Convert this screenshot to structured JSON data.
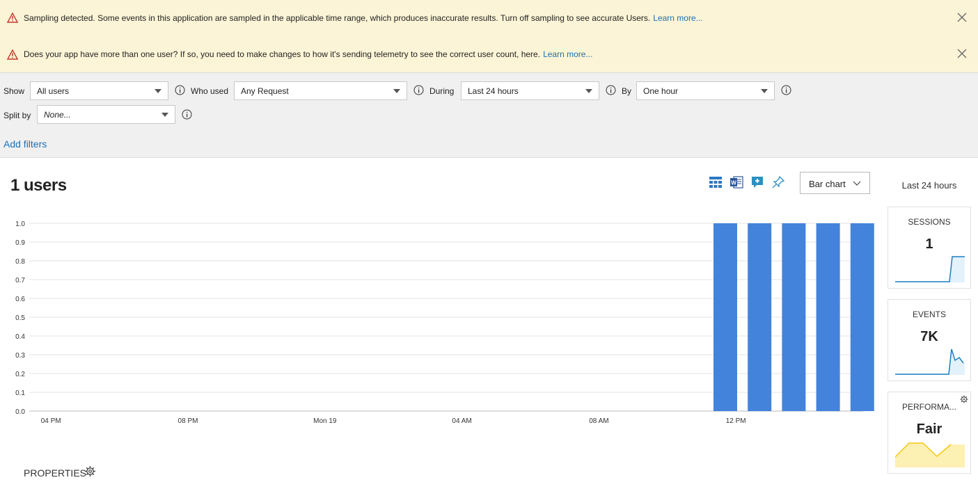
{
  "banners": [
    {
      "message": "Sampling detected. Some events in this application are sampled in the applicable time range, which produces inaccurate results. Turn off sampling to see accurate Users.",
      "link": "Learn more..."
    },
    {
      "message": "Does your app have more than one user? If so, you need to make changes to how it's sending telemetry to see the correct user count, here.",
      "link": "Learn more..."
    }
  ],
  "filters": {
    "show_label": "Show",
    "show_value": "All users",
    "who_used_label": "Who used",
    "who_used_value": "Any Request",
    "during_label": "During",
    "during_value": "Last 24 hours",
    "by_label": "By",
    "by_value": "One hour",
    "split_label": "Split by",
    "split_value": "None...",
    "add_filters": "Add filters"
  },
  "main": {
    "title": "1 users",
    "chart_type": "Bar chart",
    "time_range": "Last 24 hours"
  },
  "tiles": [
    {
      "name": "SESSIONS",
      "value": "1",
      "color": "#1a7fc1",
      "fill": "#e3f1fb"
    },
    {
      "name": "EVENTS",
      "value": "7K",
      "color": "#1a7fc1",
      "fill": "#e3f1fb"
    },
    {
      "name": "PERFORMA...",
      "value": "Fair",
      "color": "#f2c811",
      "fill": "#fdf0b3"
    }
  ],
  "properties_label": "PROPERTIES",
  "colors": {
    "bar": "#4483dc",
    "link": "#1a6fb5",
    "banner_bg": "#fcf4d6"
  },
  "chart_data": {
    "type": "bar",
    "ylim": [
      0,
      1
    ],
    "yticks": [
      "0.0",
      "0.1",
      "0.2",
      "0.3",
      "0.4",
      "0.5",
      "0.6",
      "0.7",
      "0.8",
      "0.9",
      "1.0"
    ],
    "xticks": [
      "04 PM",
      "08 PM",
      "Mon 19",
      "04 AM",
      "08 AM",
      "12 PM"
    ],
    "x_hours": [
      15,
      16,
      17,
      18,
      19,
      20,
      21,
      22,
      23,
      0,
      1,
      2,
      3,
      4,
      5,
      6,
      7,
      8,
      9,
      10,
      11,
      12,
      13,
      14,
      15
    ],
    "values": [
      0,
      0,
      0,
      0,
      0,
      0,
      0,
      0,
      0,
      0,
      0,
      0,
      0,
      0,
      0,
      0,
      0,
      0,
      0,
      0,
      1,
      1,
      1,
      1,
      1
    ]
  }
}
